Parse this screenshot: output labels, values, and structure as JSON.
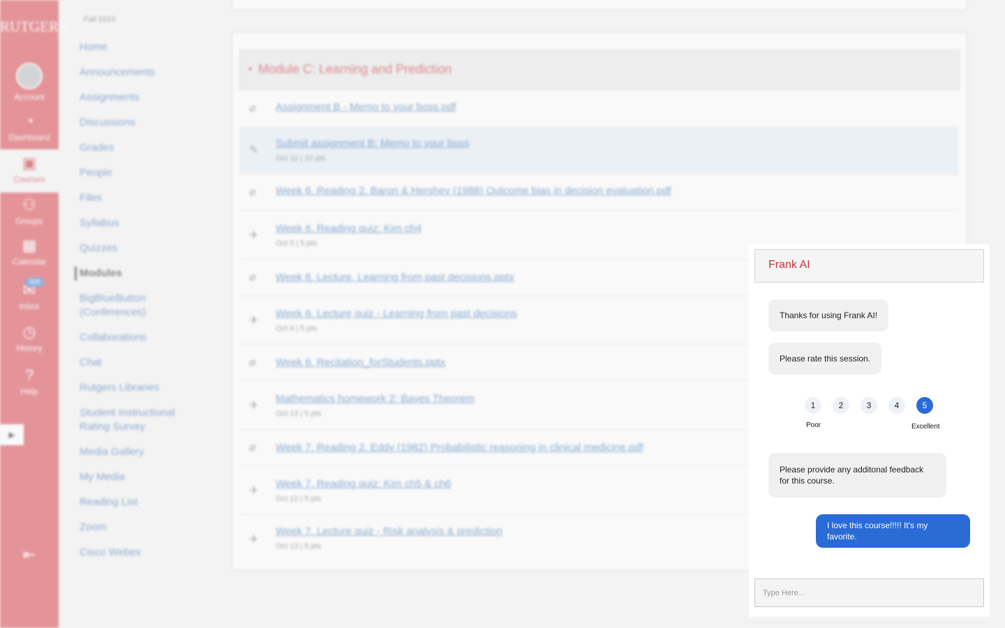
{
  "global_nav": {
    "logo": "RUTGERS",
    "items": [
      {
        "label": "Account",
        "icon": "avatar"
      },
      {
        "label": "Dashboard",
        "icon": "dashboard-icon"
      },
      {
        "label": "Courses",
        "icon": "courses-icon"
      },
      {
        "label": "Groups",
        "icon": "groups-icon"
      },
      {
        "label": "Calendar",
        "icon": "calendar-icon"
      },
      {
        "label": "Inbox",
        "icon": "inbox-icon"
      },
      {
        "label": "History",
        "icon": "history-icon"
      },
      {
        "label": "Help",
        "icon": "help-icon"
      }
    ],
    "inbox_badge": "306"
  },
  "course_nav": {
    "term": "Fall 2023",
    "links": [
      "Home",
      "Announcements",
      "Assignments",
      "Discussions",
      "Grades",
      "People",
      "Files",
      "Syllabus",
      "Quizzes",
      "Modules",
      "BigBlueButton (Conferences)",
      "Collaborations",
      "Chat",
      "Rutgers Libraries",
      "Student Instructional Rating Survey",
      "Media Gallery",
      "My Media",
      "Reading List",
      "Zoom",
      "Cisco Webex"
    ],
    "active": "Modules"
  },
  "module": {
    "title": "Module C: Learning and Prediction",
    "items": [
      {
        "type": "attachment",
        "title": "Assignment B - Memo to your boss.pdf",
        "meta": ""
      },
      {
        "type": "assignment",
        "title": "Submit assignment B: Memo to your boss",
        "meta": "Oct 10  |  10 pts"
      },
      {
        "type": "attachment",
        "title": "Week 6. Reading 2. Baron & Hershey (1988) Outcome bias in decision evaluation.pdf",
        "meta": ""
      },
      {
        "type": "quiz",
        "title": "Week 6. Reading quiz: Kim ch4",
        "meta": "Oct 5  |  5 pts"
      },
      {
        "type": "attachment",
        "title": "Week 6. Lecture. Learning from past decisions.pptx",
        "meta": ""
      },
      {
        "type": "quiz",
        "title": "Week 6. Lecture quiz - Learning from past decisions",
        "meta": "Oct 6  |  5 pts"
      },
      {
        "type": "attachment",
        "title": "Week 6. Recitation_forStudents.pptx",
        "meta": ""
      },
      {
        "type": "quiz",
        "title": "Mathematics homework 2: Bayes Theorem",
        "meta": "Oct 13  |  5 pts"
      },
      {
        "type": "attachment",
        "title": "Week 7. Reading 2. Eddy (1982) Probabilistic reasoning in clinical medicine.pdf",
        "meta": ""
      },
      {
        "type": "quiz",
        "title": "Week 7. Reading quiz: Kim ch5 & ch6",
        "meta": "Oct 12  |  5 pts"
      },
      {
        "type": "quiz",
        "title": "Week 7. Lecture quiz - Risk analysis & prediction",
        "meta": "Oct 13  |  5 pts"
      }
    ]
  },
  "chat": {
    "title": "Frank AI",
    "messages": [
      {
        "from": "bot",
        "text": "Thanks for using Frank AI!"
      },
      {
        "from": "bot",
        "text": "Please rate this session."
      },
      {
        "from": "bot",
        "text": "Please provide any additonal feedback for this course."
      },
      {
        "from": "user",
        "text": "I love this course!!!!! It's my favorite."
      }
    ],
    "rating": {
      "options": [
        "1",
        "2",
        "3",
        "4",
        "5"
      ],
      "selected": "5",
      "low_label": "Poor",
      "high_label": "Excellent"
    },
    "input_placeholder": "Type Here...",
    "accent": "#2b6bd6",
    "title_color": "#c8323a"
  }
}
